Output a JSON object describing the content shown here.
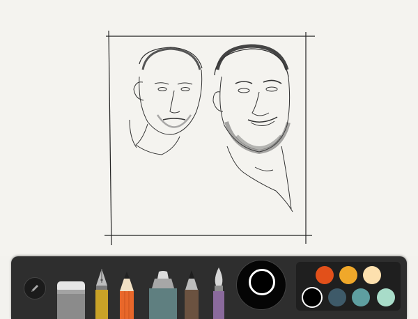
{
  "canvas": {
    "description_kind": "pencil sketch of two portraits inside a hand-drawn frame"
  },
  "toolbar": {
    "tools": [
      {
        "name": "mix-tool",
        "icon": "pen-icon"
      },
      {
        "name": "eraser-tool",
        "icon": "eraser-icon",
        "color": "#9a9a9a"
      },
      {
        "name": "fountain-pen-tool",
        "icon": "fountain-pen-icon",
        "color": "#c9a227"
      },
      {
        "name": "pencil-tool",
        "icon": "pencil-icon",
        "color": "#e8672a"
      },
      {
        "name": "marker-tool",
        "icon": "marker-icon",
        "color": "#5f7f80"
      },
      {
        "name": "outline-tool",
        "icon": "outline-pen-icon",
        "color": "#6b5240"
      },
      {
        "name": "brush-tool",
        "icon": "brush-icon",
        "color": "#8a6a9c"
      }
    ],
    "current_color": "#000000",
    "palette": [
      {
        "color": "#e2501a",
        "selected": false
      },
      {
        "color": "#f0a82a",
        "selected": false
      },
      {
        "color": "#fde0ae",
        "selected": false
      },
      {
        "color": "#000000",
        "selected": true
      },
      {
        "color": "#3e5a69",
        "selected": false
      },
      {
        "color": "#5e9ea0",
        "selected": false
      },
      {
        "color": "#a8dcc9",
        "selected": false
      }
    ]
  }
}
